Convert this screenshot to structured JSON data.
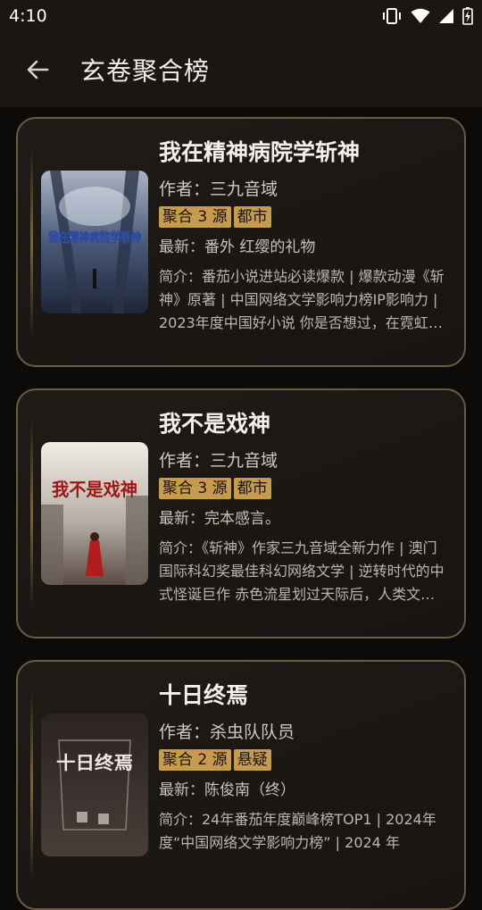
{
  "status": {
    "time": "4:10"
  },
  "header": {
    "title": "玄卷聚合榜"
  },
  "books": [
    {
      "title": "我在精神病院学斩神",
      "author": "作者：三九音域",
      "source_tag": "聚合 3 源",
      "genre_tag": "都市",
      "latest": "最新：番外 红缨的礼物",
      "intro": "简介：番茄小说进站必读爆款 | 爆款动漫《斩神》原著 | 中国网络文学影响力榜IP影响力 | 2023年度中国好小说 你是否想过，在霓虹璀璨的都市之下，潜藏着来自古老神话的怪物？",
      "cover_text": "我在精神病院学斩神"
    },
    {
      "title": "我不是戏神",
      "author": "作者：三九音域",
      "source_tag": "聚合 3 源",
      "genre_tag": "都市",
      "latest": "最新：完本感言。",
      "intro": "简介：《斩神》作家三九音域全新力作 | 澳门国际科幻奖最佳科幻网络文学 | 逆转时代的中式怪诞巨作 赤色流星划过天际后，人类文明陷入停滞。",
      "cover_text": "我不是戏神"
    },
    {
      "title": "十日终焉",
      "author": "作者：杀虫队队员",
      "source_tag": "聚合 2 源",
      "genre_tag": "悬疑",
      "latest": "最新：陈俊南（终）",
      "intro": "简介：24年番茄年度巅峰榜TOP1 | 2024年度“中国网络文学影响力榜” | 2024 年",
      "cover_text": "十日终焉"
    }
  ]
}
